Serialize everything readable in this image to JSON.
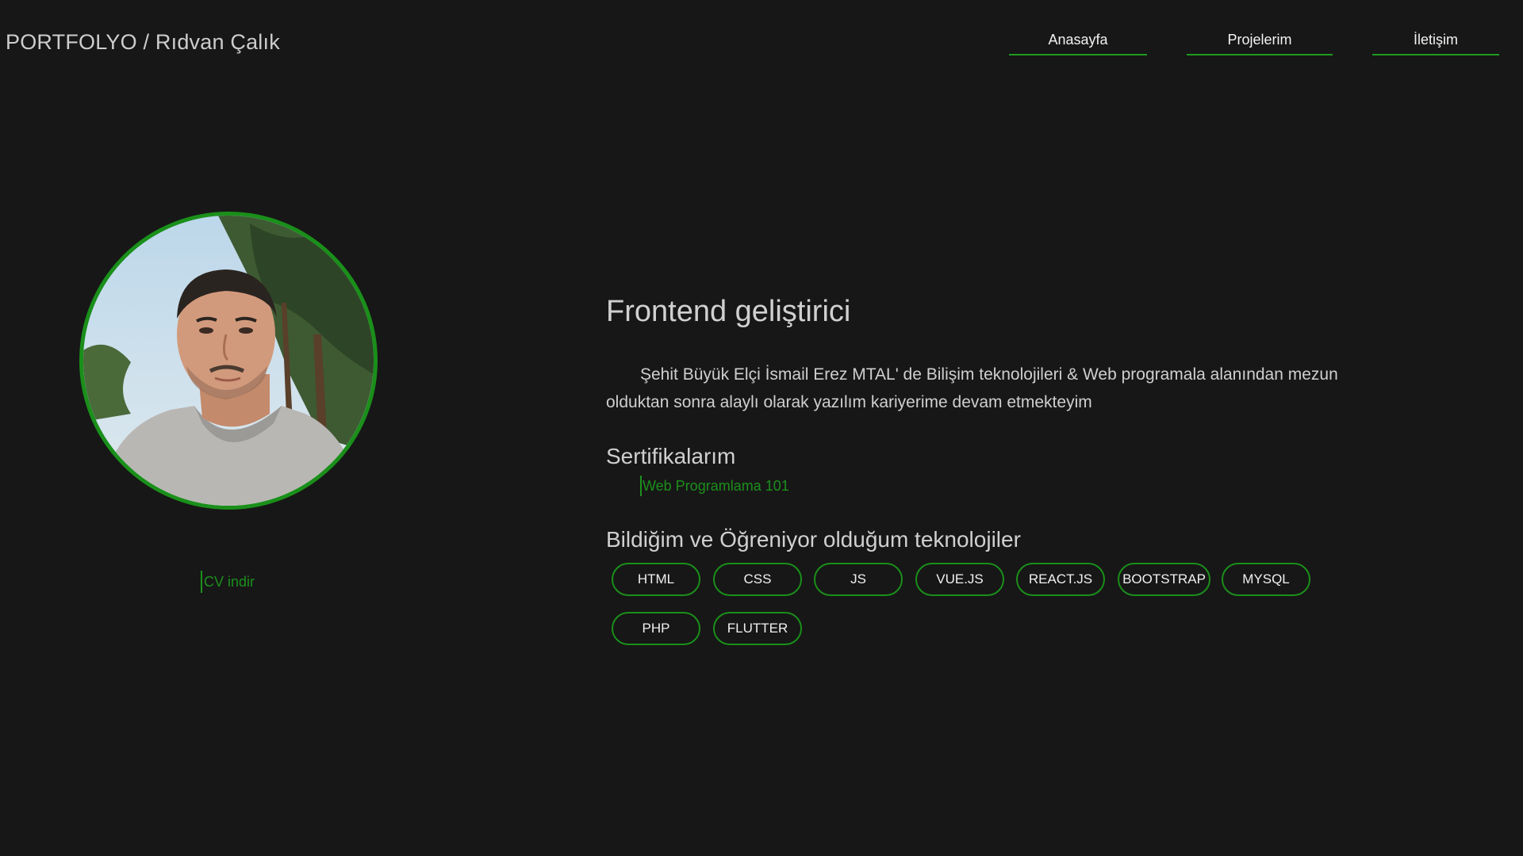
{
  "header": {
    "brand": "PORTFOLYO / Rıdvan Çalık",
    "nav": [
      {
        "label": "Anasayfa"
      },
      {
        "label": "Projelerim"
      },
      {
        "label": "İletişim"
      }
    ]
  },
  "profile": {
    "cv_link": "CV indir"
  },
  "main": {
    "role": "Frontend geliştirici",
    "bio": "Şehit Büyük Elçi İsmail Erez MTAL' de Bilişim teknolojileri & Web programala alanından mezun olduktan sonra alaylı olarak yazılım kariyerime devam etmekteyim",
    "certificates_title": "Sertifikalarım",
    "certificates": [
      {
        "label": "Web Programlama 101"
      }
    ],
    "technologies_title": "Bildiğim ve Öğreniyor olduğum teknolojiler",
    "technologies": [
      "HTML",
      "CSS",
      "JS",
      "VUE.JS",
      "REACT.JS",
      "BOOTSTRAP",
      "MYSQL",
      "PHP",
      "FLUTTER"
    ]
  },
  "colors": {
    "background": "#171717",
    "accent": "#1a8f1a",
    "text": "#cfcfcf"
  }
}
